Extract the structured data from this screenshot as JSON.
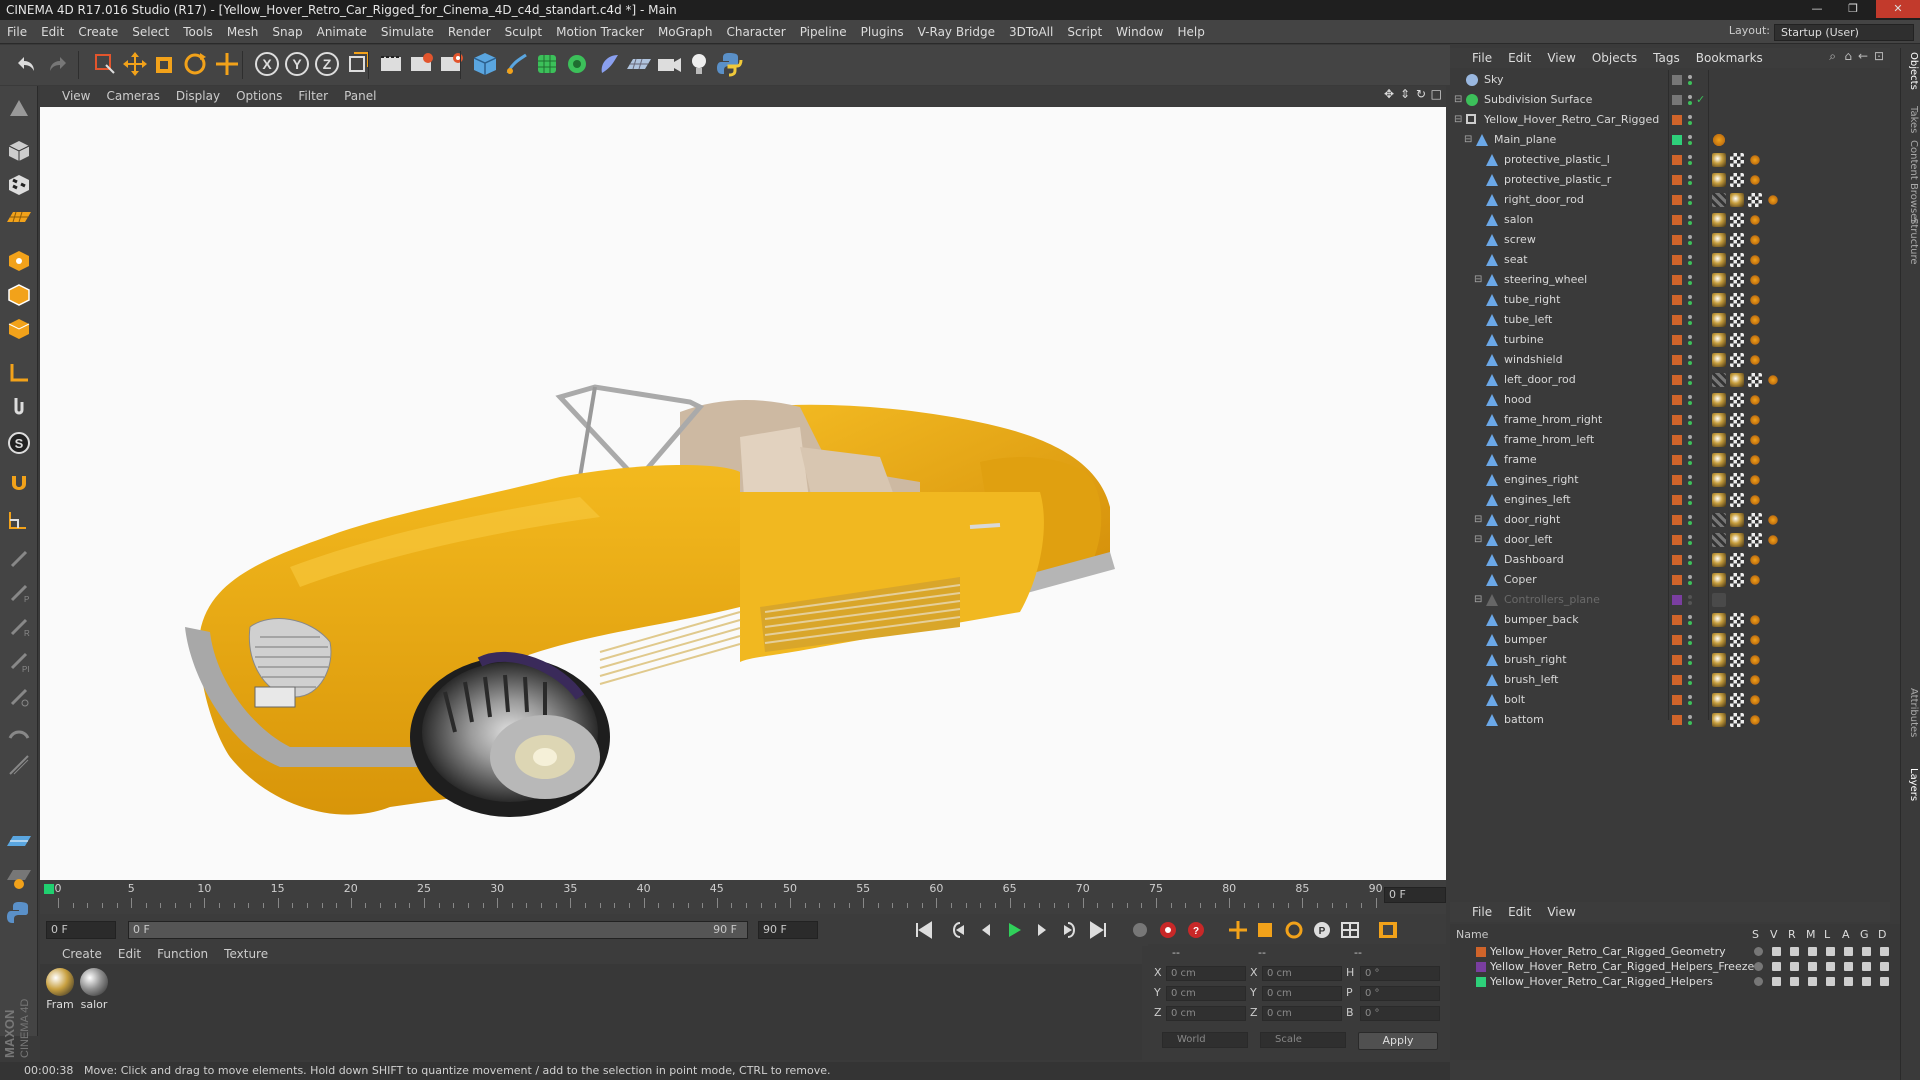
{
  "window": {
    "title": "CINEMA 4D R17.016 Studio (R17) - [Yellow_Hover_Retro_Car_Rigged_for_Cinema_4D_c4d_standart.c4d *] - Main"
  },
  "menu": [
    "File",
    "Edit",
    "Create",
    "Select",
    "Tools",
    "Mesh",
    "Snap",
    "Animate",
    "Simulate",
    "Render",
    "Sculpt",
    "Motion Tracker",
    "MoGraph",
    "Character",
    "Pipeline",
    "Plugins",
    "V-Ray Bridge",
    "3DToAll",
    "Script",
    "Window",
    "Help"
  ],
  "layout": {
    "label": "Layout:",
    "value": "Startup (User)"
  },
  "toolbar_icons": [
    "undo-icon",
    "redo-icon",
    "live-selection-icon",
    "move-icon",
    "scale-icon",
    "rotate-icon",
    "transform-icon",
    "x-axis-icon",
    "y-axis-icon",
    "z-axis-icon",
    "world-coordinates-icon",
    "render-view-icon",
    "render-picture-viewer-icon",
    "render-settings-icon",
    "cube-icon",
    "pen-icon",
    "subdivision-icon",
    "array-icon",
    "deformer-icon",
    "floor-icon",
    "camera-icon",
    "light-icon",
    "python-icon"
  ],
  "viewport": {
    "menu": [
      "View",
      "Cameras",
      "Display",
      "Options",
      "Filter",
      "Panel"
    ]
  },
  "timeline": {
    "ticks": [
      "0",
      "5",
      "10",
      "15",
      "20",
      "25",
      "30",
      "35",
      "40",
      "45",
      "50",
      "55",
      "60",
      "65",
      "70",
      "75",
      "80",
      "85",
      "90"
    ],
    "frame": "0 F",
    "start": "0 F",
    "range_start": "0 F",
    "range_end": "90 F",
    "end": "90 F"
  },
  "materials": {
    "menu": [
      "Create",
      "Edit",
      "Function",
      "Texture"
    ],
    "items": [
      {
        "label": "Fram",
        "color": "#c8a040"
      },
      {
        "label": "salor",
        "color": "#8f8f8f"
      }
    ]
  },
  "coordinates": {
    "headers": [
      "--",
      "--",
      "--"
    ],
    "rows": [
      {
        "a": "X",
        "av": "0 cm",
        "b": "X",
        "bv": "0 cm",
        "c": "H",
        "cv": "0 °"
      },
      {
        "a": "Y",
        "av": "0 cm",
        "b": "Y",
        "bv": "0 cm",
        "c": "P",
        "cv": "0 °"
      },
      {
        "a": "Z",
        "av": "0 cm",
        "b": "Z",
        "bv": "0 cm",
        "c": "B",
        "cv": "0 °"
      }
    ],
    "mode": "World",
    "type": "Scale",
    "apply": "Apply"
  },
  "status": {
    "time": "00:00:38",
    "message": "Move: Click and drag to move elements. Hold down SHIFT to quantize movement / add to the selection in point mode, CTRL to remove."
  },
  "object_manager": {
    "menu": [
      "File",
      "Edit",
      "View",
      "Objects",
      "Tags",
      "Bookmarks"
    ],
    "objects": [
      {
        "name": "Sky",
        "depth": 0,
        "kind": "sky"
      },
      {
        "name": "Subdivision Surface",
        "depth": 0,
        "kind": "subd"
      },
      {
        "name": "Yellow_Hover_Retro_Car_Rigged",
        "depth": 1,
        "kind": "null"
      },
      {
        "name": "Main_plane",
        "depth": 2,
        "kind": "bone"
      },
      {
        "name": "protective_plastic_l",
        "depth": 3,
        "kind": "bone"
      },
      {
        "name": "protective_plastic_r",
        "depth": 3,
        "kind": "bone"
      },
      {
        "name": "right_door_rod",
        "depth": 3,
        "kind": "bone"
      },
      {
        "name": "salon",
        "depth": 3,
        "kind": "bone"
      },
      {
        "name": "screw",
        "depth": 3,
        "kind": "bone"
      },
      {
        "name": "seat",
        "depth": 3,
        "kind": "bone"
      },
      {
        "name": "steering_wheel",
        "depth": 3,
        "kind": "bone"
      },
      {
        "name": "tube_right",
        "depth": 3,
        "kind": "bone"
      },
      {
        "name": "tube_left",
        "depth": 3,
        "kind": "bone"
      },
      {
        "name": "turbine",
        "depth": 3,
        "kind": "bone"
      },
      {
        "name": "windshield",
        "depth": 3,
        "kind": "bone"
      },
      {
        "name": "left_door_rod",
        "depth": 3,
        "kind": "bone"
      },
      {
        "name": "hood",
        "depth": 3,
        "kind": "bone"
      },
      {
        "name": "frame_hrom_right",
        "depth": 3,
        "kind": "bone"
      },
      {
        "name": "frame_hrom_left",
        "depth": 3,
        "kind": "bone"
      },
      {
        "name": "frame",
        "depth": 3,
        "kind": "bone"
      },
      {
        "name": "engines_right",
        "depth": 3,
        "kind": "bone"
      },
      {
        "name": "engines_left",
        "depth": 3,
        "kind": "bone"
      },
      {
        "name": "door_right",
        "depth": 3,
        "kind": "bone"
      },
      {
        "name": "door_left",
        "depth": 3,
        "kind": "bone"
      },
      {
        "name": "Dashboard",
        "depth": 3,
        "kind": "bone"
      },
      {
        "name": "Coper",
        "depth": 3,
        "kind": "bone"
      },
      {
        "name": "Controllers_plane",
        "depth": 3,
        "kind": "hidden"
      },
      {
        "name": "bumper_back",
        "depth": 3,
        "kind": "bone"
      },
      {
        "name": "bumper",
        "depth": 3,
        "kind": "bone"
      },
      {
        "name": "brush_right",
        "depth": 3,
        "kind": "bone"
      },
      {
        "name": "brush_left",
        "depth": 3,
        "kind": "bone"
      },
      {
        "name": "bolt",
        "depth": 3,
        "kind": "bone"
      },
      {
        "name": "battom",
        "depth": 3,
        "kind": "bone"
      }
    ]
  },
  "layer_manager": {
    "menu": [
      "File",
      "Edit",
      "View"
    ],
    "name_header": "Name",
    "columns": [
      "S",
      "V",
      "R",
      "M",
      "L",
      "A",
      "G",
      "D"
    ],
    "layers": [
      {
        "name": "Yellow_Hover_Retro_Car_Rigged_Geometry",
        "color": "#d0642a"
      },
      {
        "name": "Yellow_Hover_Retro_Car_Rigged_Helpers_Freeze",
        "color": "#7a3ea0"
      },
      {
        "name": "Yellow_Hover_Retro_Car_Rigged_Helpers",
        "color": "#2ed07a"
      }
    ]
  },
  "side_tabs": [
    "Objects",
    "Takes",
    "Content Browser",
    "Structure",
    "Attributes",
    "Layers"
  ]
}
